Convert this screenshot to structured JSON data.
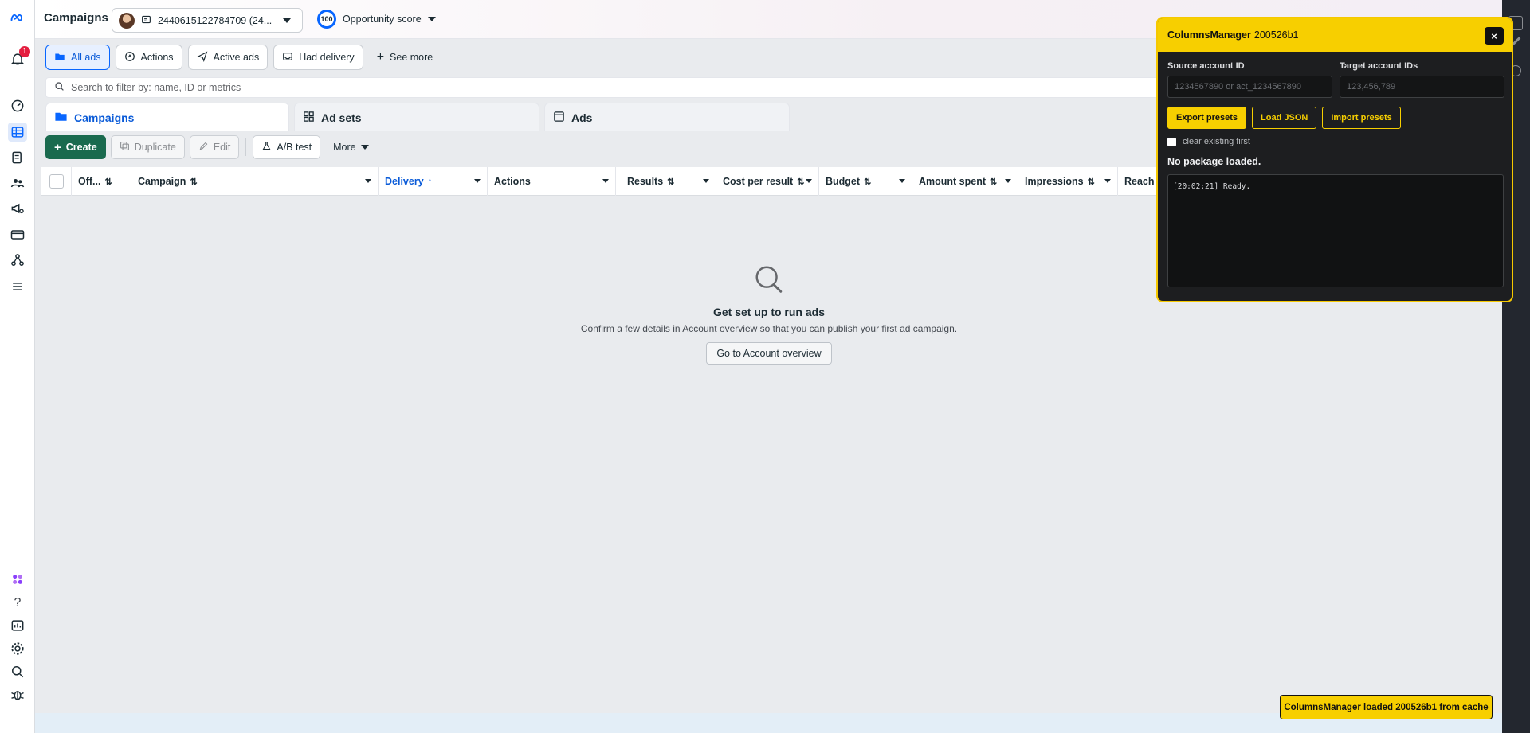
{
  "header": {
    "title": "Campaigns",
    "account_label": "2440615122784709 (24...",
    "opportunity_value": "100",
    "opportunity_label": "Opportunity score"
  },
  "notifications": {
    "count": "1"
  },
  "filters": [
    {
      "label": "All ads",
      "icon": "folder-icon",
      "active": true
    },
    {
      "label": "Actions",
      "icon": "actions-icon",
      "active": false
    },
    {
      "label": "Active ads",
      "icon": "send-icon",
      "active": false
    },
    {
      "label": "Had delivery",
      "icon": "inbox-icon",
      "active": false
    },
    {
      "label": "See more",
      "icon": "plus-icon",
      "active": false
    }
  ],
  "search": {
    "placeholder": "Search to filter by: name, ID or metrics"
  },
  "level_tabs": [
    {
      "label": "Campaigns",
      "selected": true
    },
    {
      "label": "Ad sets",
      "selected": false
    },
    {
      "label": "Ads",
      "selected": false
    }
  ],
  "toolbar": {
    "create": "Create",
    "duplicate": "Duplicate",
    "edit": "Edit",
    "ab_test": "A/B test",
    "more": "More"
  },
  "table": {
    "columns": [
      {
        "label": "Off...",
        "sort": "⇅"
      },
      {
        "label": "Campaign",
        "sort": "⇅"
      },
      {
        "label": "Delivery",
        "sort": "↑"
      },
      {
        "label": "Actions",
        "sort": ""
      },
      {
        "label": "Results",
        "sort": "⇅"
      },
      {
        "label": "Cost per result",
        "sort": "⇅"
      },
      {
        "label": "Budget",
        "sort": "⇅"
      },
      {
        "label": "Amount spent",
        "sort": "⇅"
      },
      {
        "label": "Impressions",
        "sort": "⇅"
      },
      {
        "label": "Reach",
        "sort": ""
      }
    ]
  },
  "empty_state": {
    "title": "Get set up to run ads",
    "subtitle": "Confirm a few details in Account overview so that you can publish your first ad campaign.",
    "button": "Go to Account overview"
  },
  "columns_manager": {
    "title": "ColumnsManager",
    "version": "200526b1",
    "close": "×",
    "source_label": "Source account ID",
    "source_placeholder": "1234567890 or act_1234567890",
    "target_label": "Target account IDs",
    "target_placeholder": "123,456,789",
    "export_btn": "Export presets",
    "load_btn": "Load JSON",
    "import_btn": "Import presets",
    "clear_label": "clear existing first",
    "status": "No package loaded.",
    "log": "[20:02:21] Ready."
  },
  "toast": {
    "message": "ColumnsManager loaded 200526b1 from cache"
  },
  "colors": {
    "accent": "#0866ff",
    "create_green": "#1a6a4e",
    "cm_yellow": "#f7cf00"
  }
}
